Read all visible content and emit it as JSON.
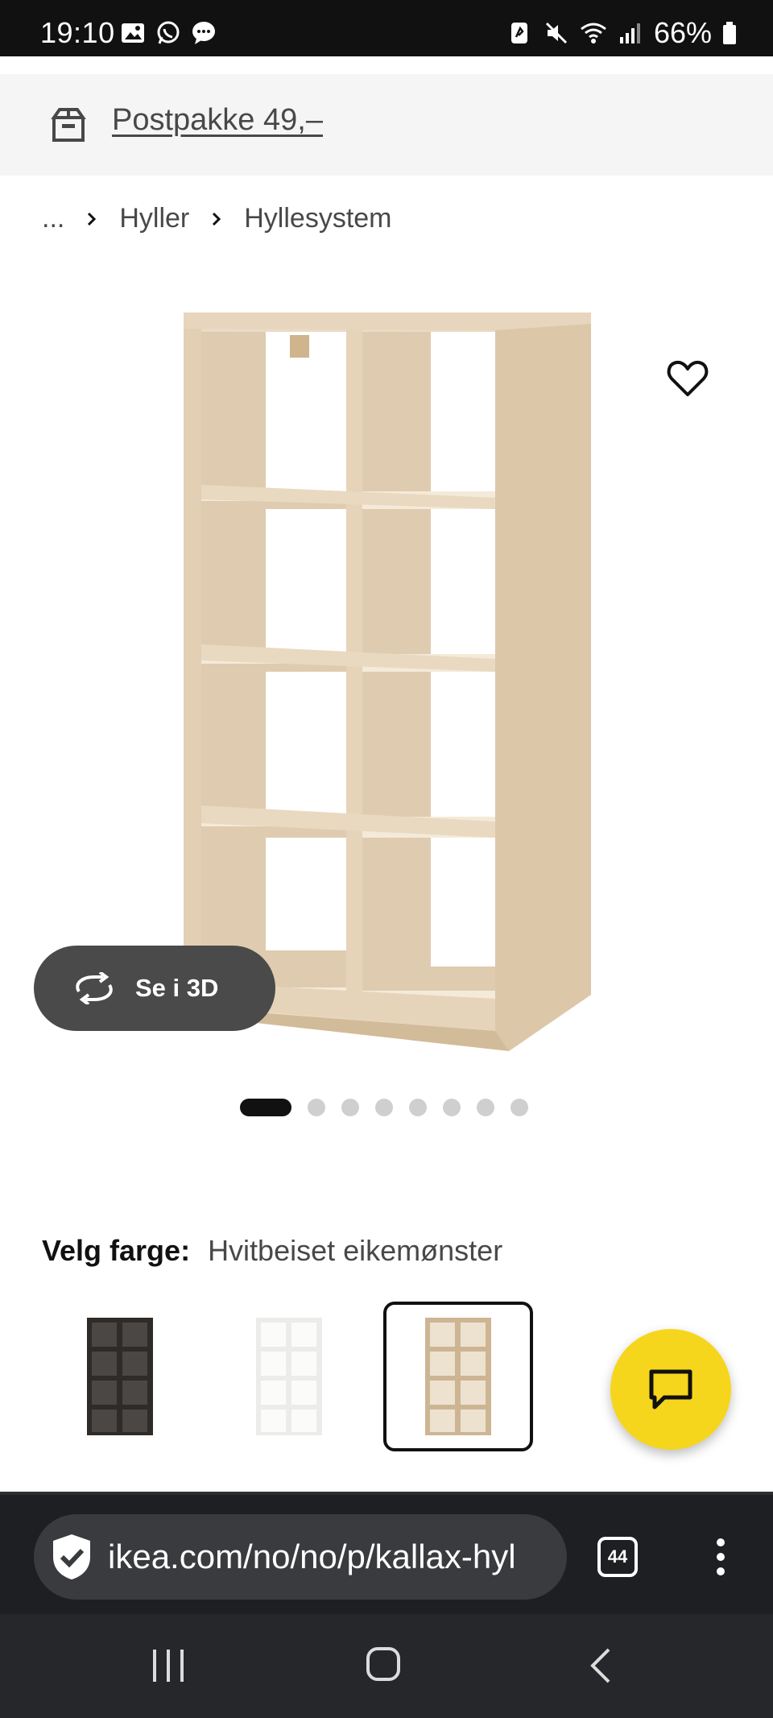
{
  "status_bar": {
    "time": "19:10",
    "battery": "66%",
    "icons": [
      "gallery-icon",
      "whatsapp-icon",
      "message-icon",
      "nfc-icon",
      "mute-icon",
      "wifi-icon",
      "signal-icon",
      "battery-icon"
    ]
  },
  "delivery_banner": {
    "icon": "parcel-icon",
    "text": "Postpakke 49,–"
  },
  "breadcrumb": {
    "items": [
      "...",
      "Hyller",
      "Hyllesystem"
    ]
  },
  "product": {
    "image_icon": "kallax-shelf-unit",
    "favorite_icon": "heart-icon",
    "view_3d_label": "Se i 3D",
    "carousel": {
      "count": 8,
      "active_index": 0
    }
  },
  "color_chooser": {
    "label": "Velg farge:",
    "value": "Hvitbeiset eikemønster",
    "swatches": [
      {
        "color": "#2e2b29",
        "selected": false
      },
      {
        "color": "#f5f5f3",
        "selected": false
      },
      {
        "color": "#d8c3a5",
        "selected": true
      }
    ]
  },
  "chat": {
    "icon": "chat-icon",
    "color": "#f6d61c"
  },
  "browser": {
    "url": "ikea.com/no/no/p/kallax-hyl",
    "tab_count": "44",
    "menu_icon": "more-vertical-icon",
    "security_icon": "shield-check-icon"
  },
  "nav_bar": {
    "buttons": [
      "recents-icon",
      "home-icon",
      "back-icon"
    ]
  }
}
